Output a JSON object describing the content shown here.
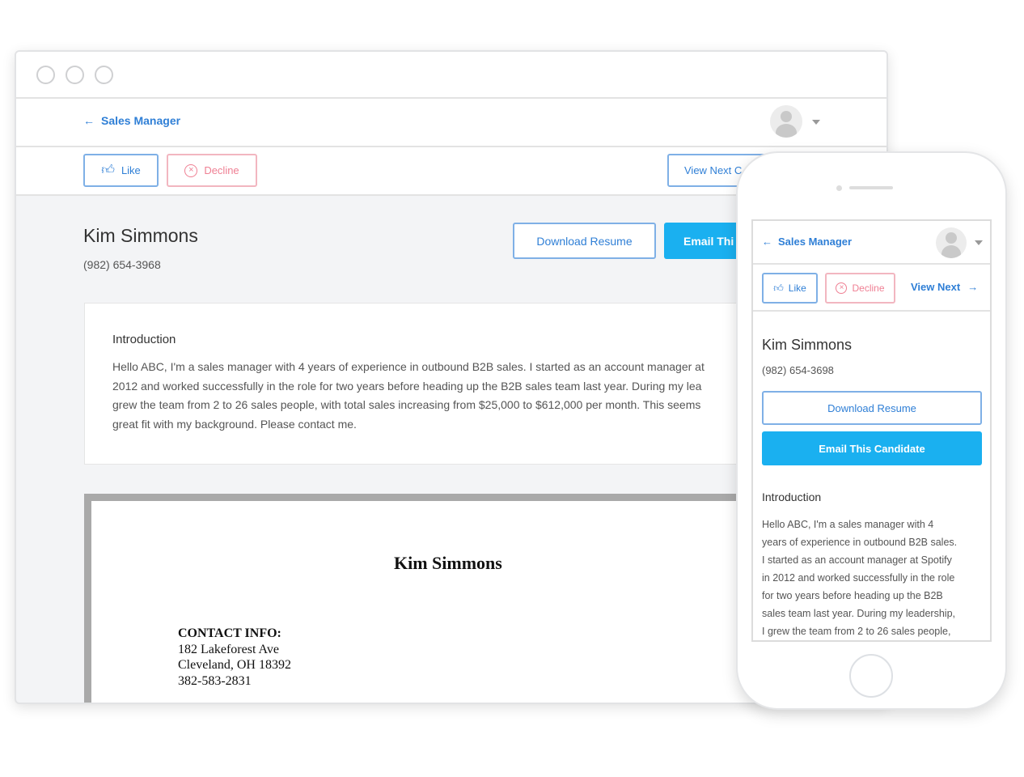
{
  "desktop": {
    "breadcrumb": "Sales Manager",
    "like_label": "Like",
    "decline_label": "Decline",
    "view_next_label": "View Next C",
    "candidate_name": "Kim Simmons",
    "candidate_phone": "(982) 654-3968",
    "download_label": "Download Resume",
    "email_label": "Email Thi",
    "intro_heading": "Introduction",
    "intro_lines": [
      "Hello ABC, I'm a sales manager with 4 years of experience in outbound B2B sales. I started as an account manager at",
      "2012 and worked successfully in the role for two years before heading up the B2B sales team last year. During my lea",
      "grew the team from 2 to 26 sales people, with total sales increasing from $25,000 to $612,000 per month. This seems",
      "great fit with my background. Please contact me."
    ],
    "resume": {
      "name": "Kim Simmons",
      "contact_heading": "CONTACT INFO:",
      "contact_lines": [
        "182 Lakeforest Ave",
        "Cleveland, OH 18392",
        "382-583-2831"
      ]
    }
  },
  "mobile": {
    "breadcrumb": "Sales Manager",
    "like_label": "Like",
    "decline_label": "Decline",
    "view_next_label": "View Next",
    "candidate_name": "Kim Simmons",
    "candidate_phone": "(982) 654-3698",
    "download_label": "Download Resume",
    "email_label": "Email This Candidate",
    "intro_heading": "Introduction",
    "intro_lines": [
      "Hello ABC, I'm a sales manager with 4",
      "years of experience in outbound B2B sales.",
      "I started as an account manager at Spotify",
      "in 2012 and worked successfully in the role",
      "for two years before heading up the B2B",
      "sales team last year. During my leadership,",
      "I grew the team from 2 to 26 sales people,"
    ]
  },
  "colors": {
    "accent": "#2f7fd6",
    "primary": "#1ab0f0",
    "decline": "#ef7f93",
    "background": "#f3f4f6"
  }
}
